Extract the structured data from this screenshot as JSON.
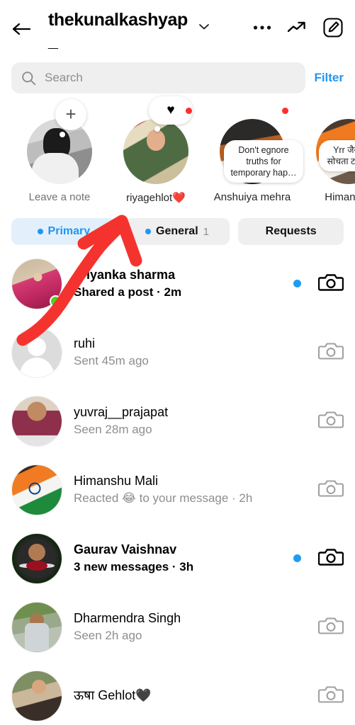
{
  "header": {
    "account_name": "thekunalkashyap_",
    "back_icon": "back-arrow-icon",
    "chevron_icon": "chevron-down-icon",
    "more_icon": "more-options-icon",
    "insights_icon": "trending-arrow-icon",
    "compose_icon": "compose-edit-icon"
  },
  "search": {
    "placeholder": "Search",
    "icon": "search-icon",
    "filter_label": "Filter",
    "filter_color": "#2196f3"
  },
  "notes": [
    {
      "label": "Leave a note",
      "bubble_text": "+",
      "bubble_type": "plus",
      "has_story_dot": false,
      "avatar": "pic-note1"
    },
    {
      "label": "riyagehlot❤️",
      "bubble_text": "♥",
      "bubble_type": "heart",
      "has_story_dot": true,
      "avatar": "pic-note2"
    },
    {
      "label": "Anshuiya mehra",
      "bubble_text": "Don't egnore truths for temporary hap…",
      "bubble_type": "text",
      "has_story_dot": true,
      "avatar": "pic-note3"
    },
    {
      "label": "Himanshu",
      "bubble_text": "Yrr जैसे पढ़ का सोचता टाइम कुछ न",
      "bubble_type": "text",
      "has_story_dot": true,
      "avatar": "pic-note4"
    }
  ],
  "tabs": [
    {
      "label": "Primary",
      "count": "",
      "active": true,
      "has_dot": true
    },
    {
      "label": "General",
      "count": "1",
      "active": false,
      "has_dot": true
    },
    {
      "label": "Requests",
      "count": "",
      "active": false,
      "has_dot": false
    }
  ],
  "threads": [
    {
      "name": "priyanka sharma",
      "subtitle": "Shared a post · 2m",
      "unread": true,
      "online": true,
      "avatar": "pic-priyanka",
      "camera_icon": "camera-icon"
    },
    {
      "name": "ruhi",
      "subtitle": "Sent 45m ago",
      "unread": false,
      "online": false,
      "avatar": "pic-default",
      "camera_icon": "camera-icon"
    },
    {
      "name": "yuvraj__prajapat",
      "subtitle": "Seen 28m ago",
      "unread": false,
      "online": false,
      "avatar": "pic-yuvraj",
      "camera_icon": "camera-icon"
    },
    {
      "name": "Himanshu Mali",
      "subtitle": "Reacted 😂 to your message · 2h",
      "unread": false,
      "online": false,
      "avatar": "pic-flag",
      "camera_icon": "camera-icon"
    },
    {
      "name": "Gaurav Vaishnav",
      "subtitle": "3 new messages · 3h",
      "unread": true,
      "online": false,
      "avatar": "pic-gaurav",
      "camera_icon": "camera-icon"
    },
    {
      "name": "Dharmendra Singh",
      "subtitle": "Seen 2h ago",
      "unread": false,
      "online": false,
      "avatar": "pic-dharmendra",
      "camera_icon": "camera-icon"
    },
    {
      "name": "ऊषा Gehlot🖤",
      "subtitle": "",
      "unread": false,
      "online": false,
      "avatar": "pic-usha",
      "camera_icon": "camera-icon"
    }
  ],
  "annotation": {
    "type": "hand-drawn-arrow",
    "color": "#f5332e",
    "points_at": "Primary"
  }
}
